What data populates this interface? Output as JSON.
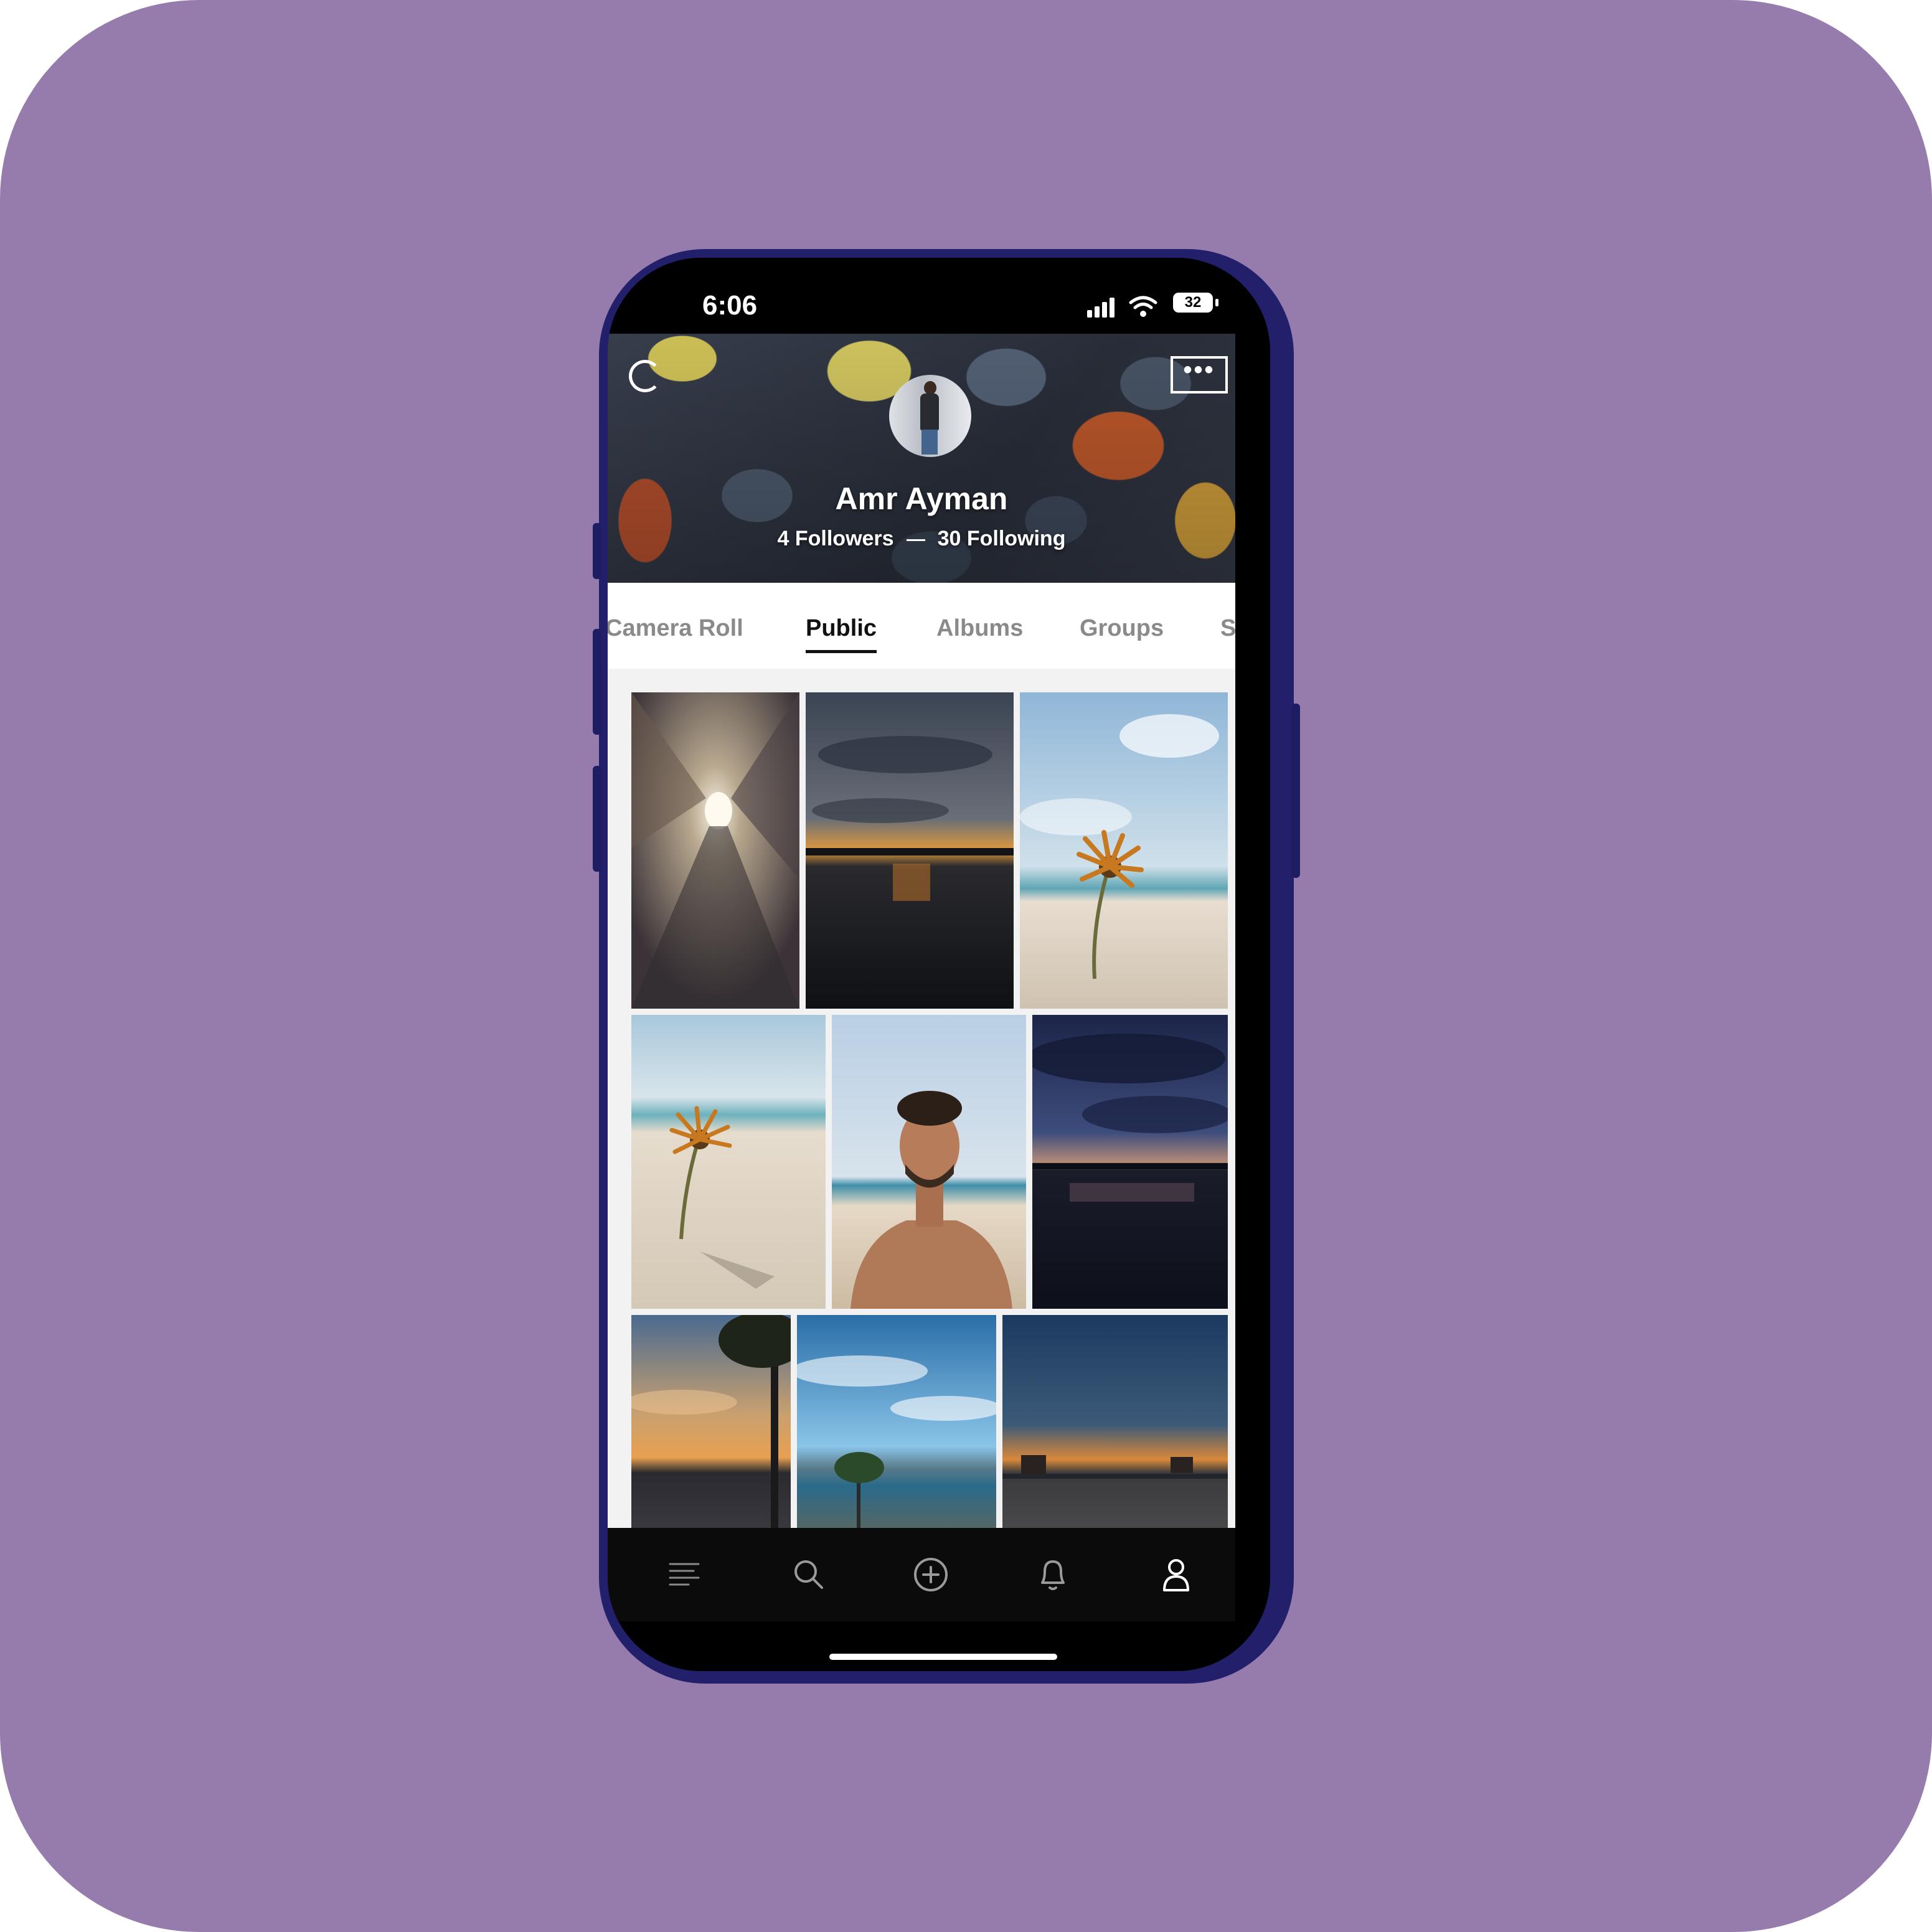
{
  "status_bar": {
    "time": "6:06",
    "battery": "32"
  },
  "profile": {
    "name": "Amr Ayman",
    "followers": "4 Followers",
    "following": "30 Following"
  },
  "tabs": [
    {
      "label": "Camera Roll",
      "active": false
    },
    {
      "label": "Public",
      "active": true
    },
    {
      "label": "Albums",
      "active": false
    },
    {
      "label": "Groups",
      "active": false
    },
    {
      "label": "Sta",
      "active": false
    }
  ],
  "photos": [
    {
      "subject": "light tunnel corridor"
    },
    {
      "subject": "sunset over water"
    },
    {
      "subject": "flower on beach"
    },
    {
      "subject": "flower on beach close"
    },
    {
      "subject": "man on beach portrait"
    },
    {
      "subject": "dusk skyline over water"
    },
    {
      "subject": "sunset with tree"
    },
    {
      "subject": "blue sky with clouds"
    },
    {
      "subject": "sunset over plaza"
    }
  ],
  "bottom_nav": [
    {
      "icon": "feed-icon"
    },
    {
      "icon": "search-icon"
    },
    {
      "icon": "add-icon"
    },
    {
      "icon": "bell-icon"
    },
    {
      "icon": "profile-icon",
      "active": true
    }
  ],
  "colors": {
    "background": "#967cad",
    "phone_frame": "#22206b",
    "active_tab": "#111111",
    "inactive_tab": "#8a8a8a"
  }
}
